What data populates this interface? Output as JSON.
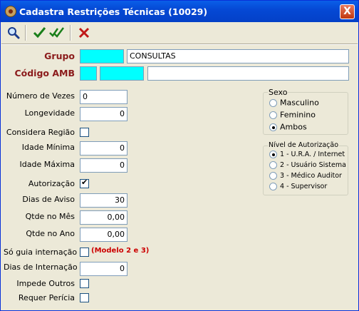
{
  "window": {
    "title": "Cadastra Restrições Técnicas (10029)",
    "close_label": "X"
  },
  "toolbar": {
    "buttons": [
      "search-icon",
      "check-icon",
      "double-check-icon",
      "cancel-x-icon"
    ]
  },
  "grupo": {
    "label": "Grupo",
    "code": "",
    "value": "CONSULTAS"
  },
  "codigo_amb": {
    "label": "Código AMB",
    "part1": "",
    "part2": "",
    "description": ""
  },
  "fields": {
    "numero_vezes": {
      "label": "Número de Vezes",
      "value": "0"
    },
    "longevidade": {
      "label": "Longevidade",
      "value": "0"
    },
    "considera_regiao": {
      "label": "Considera Região",
      "checked": false
    },
    "idade_minima": {
      "label": "Idade Mínima",
      "value": "0"
    },
    "idade_maxima": {
      "label": "Idade Máxima",
      "value": "0"
    },
    "autorizacao": {
      "label": "Autorização",
      "checked": true
    },
    "dias_aviso": {
      "label": "Dias de Aviso",
      "value": "30"
    },
    "qtde_mes": {
      "label": "Qtde no Mês",
      "value": "0,00"
    },
    "qtde_ano": {
      "label": "Qtde no Ano",
      "value": "0,00"
    },
    "so_guia": {
      "label": "Só guia internação",
      "checked": false,
      "note": "(Modelo 2 e 3)"
    },
    "dias_internacao": {
      "label": "Dias de Internação",
      "value": "0"
    },
    "impede_outros": {
      "label": "Impede Outros",
      "checked": false
    },
    "requer_pericia": {
      "label": "Requer Perícia",
      "checked": false
    }
  },
  "sexo": {
    "title": "Sexo",
    "options": [
      "Masculino",
      "Feminino",
      "Ambos"
    ],
    "selected": "Ambos"
  },
  "nivel": {
    "title": "Nível de Autorização",
    "options": [
      "1 - U.R.A. / Internet",
      "2 - Usuário Sistema",
      "3 - Médico Auditor",
      "4 - Supervisor"
    ],
    "selected": "1 - U.R.A. / Internet"
  },
  "colors": {
    "cyan": "#00ffff",
    "label_red": "#8b1b1b",
    "note_red": "#cc0000",
    "title_blue": "#0549d5"
  }
}
